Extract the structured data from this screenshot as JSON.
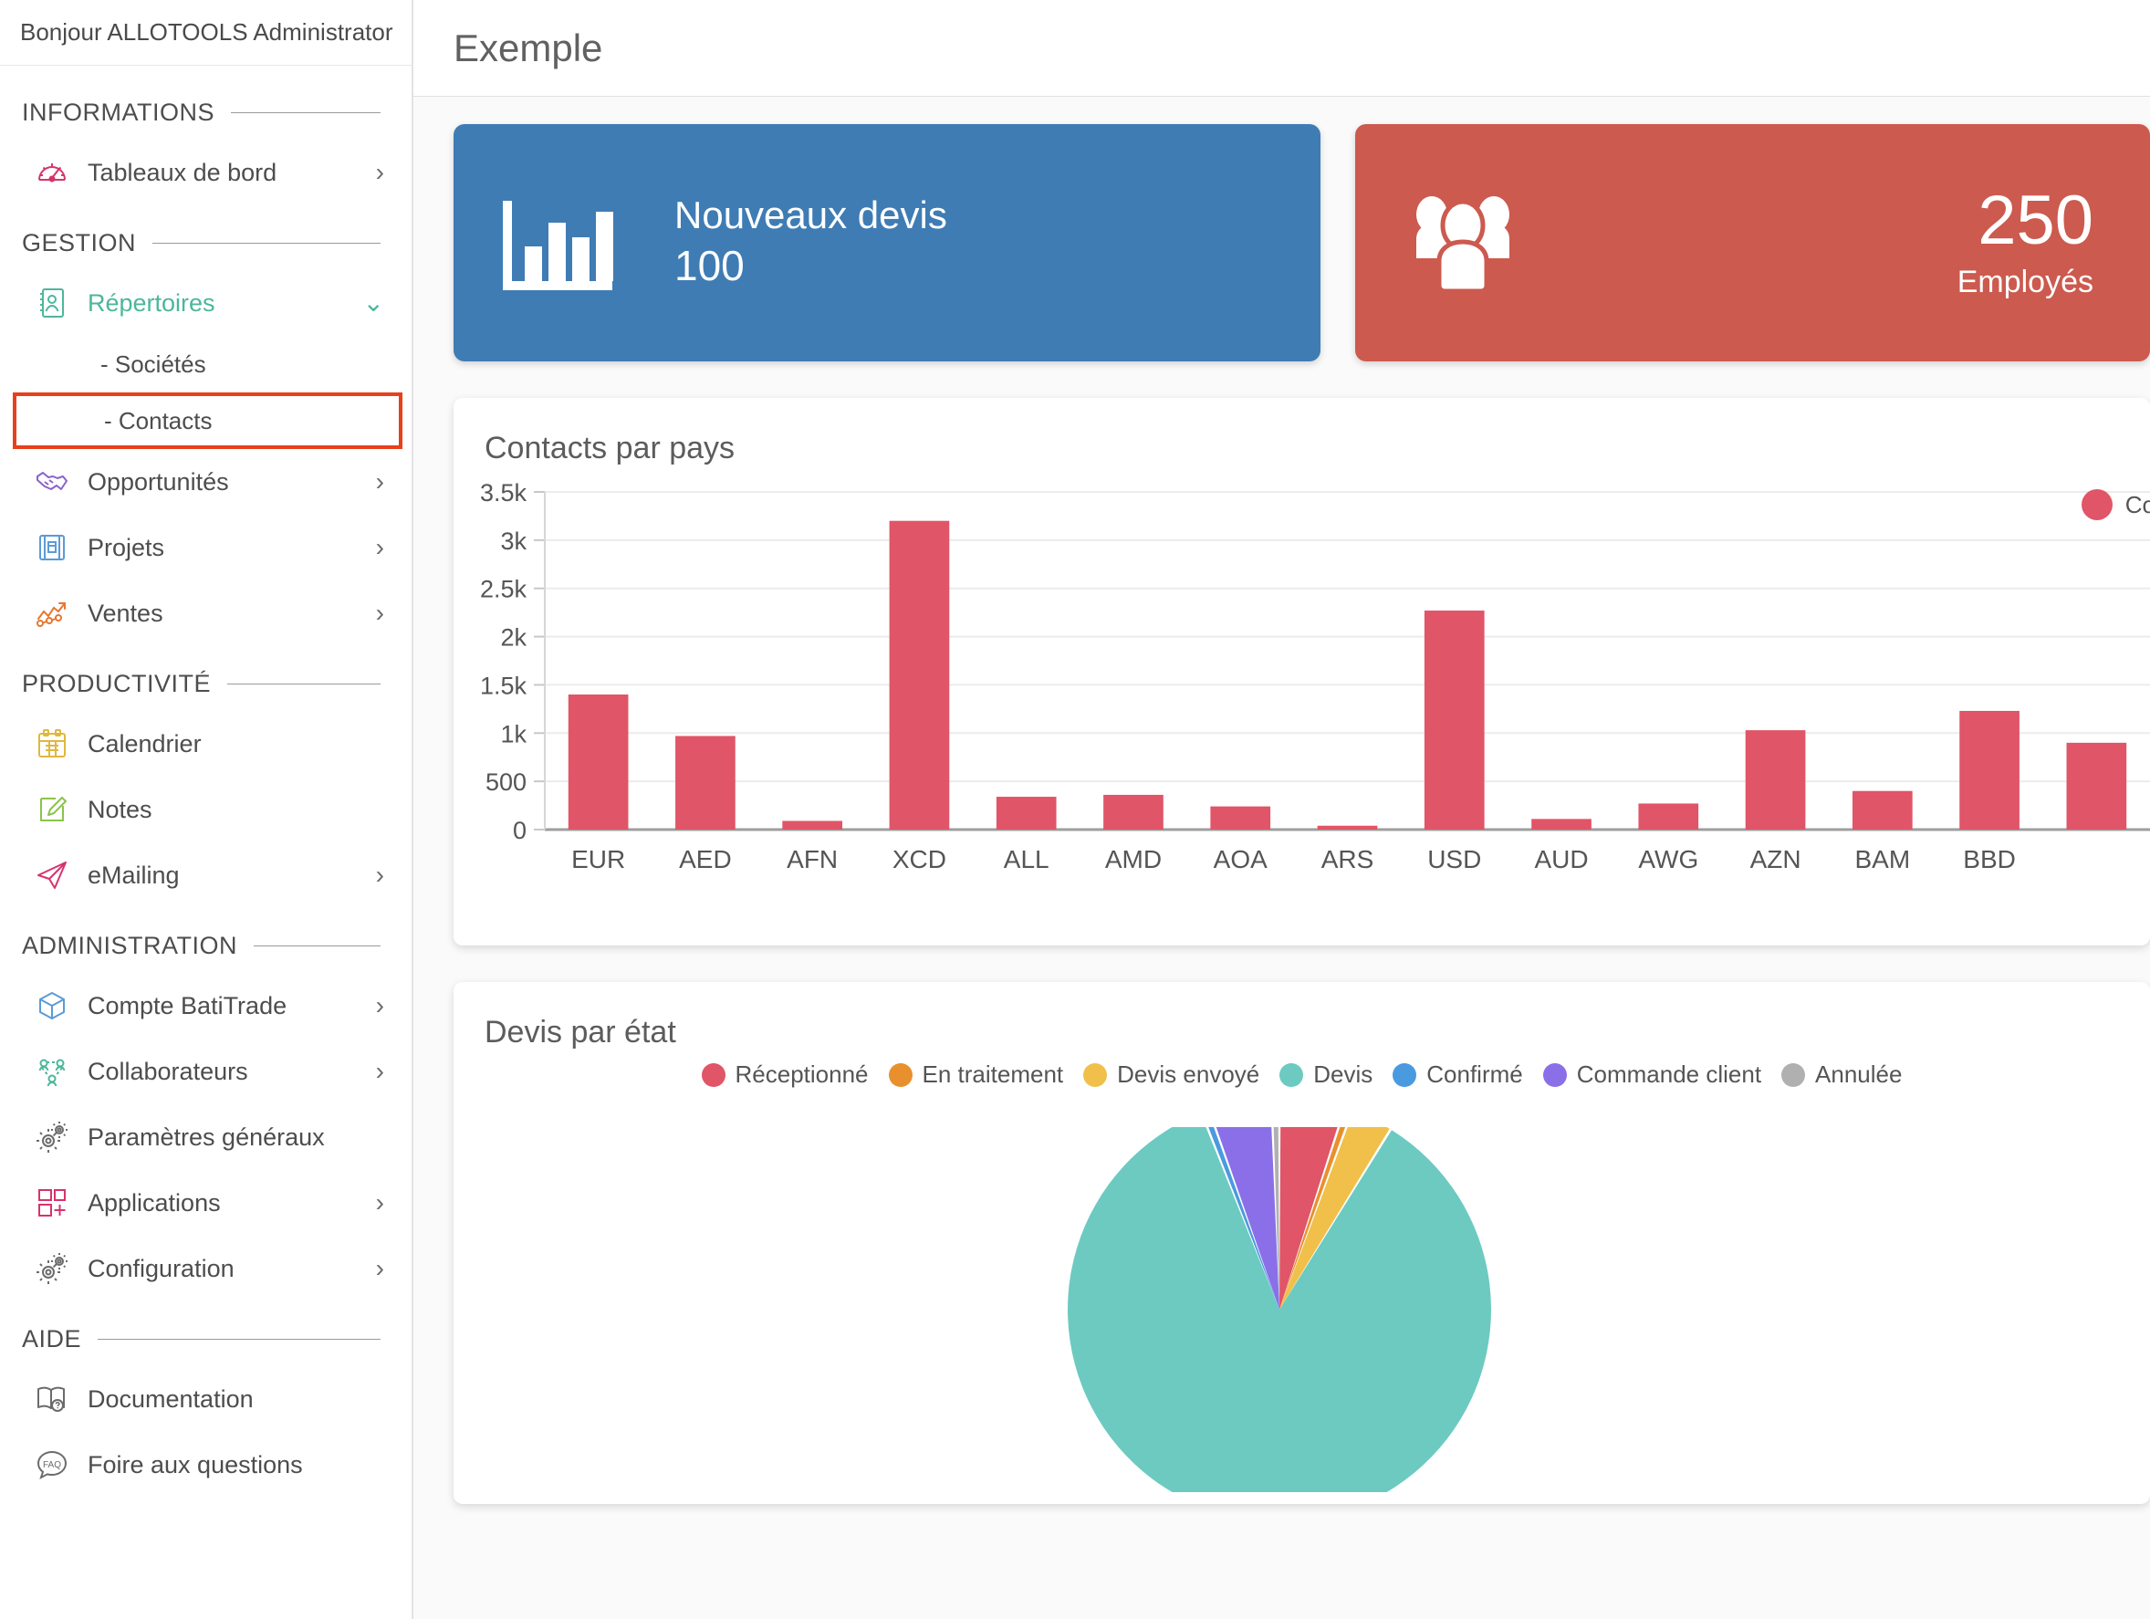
{
  "sidebar": {
    "greeting": "Bonjour ALLOTOOLS Administrator",
    "sections": [
      {
        "title": "INFORMATIONS",
        "items": [
          {
            "label": "Tableaux de bord",
            "icon": "gauge-icon",
            "chevron": "›",
            "active": false,
            "color": "#d6336c"
          }
        ]
      },
      {
        "title": "GESTION",
        "items": [
          {
            "label": "Répertoires",
            "icon": "address-book-icon",
            "chevron": "⌄",
            "active": true,
            "color": "#4cb79a"
          },
          {
            "label": "- Sociétés",
            "sub": true,
            "highlight": false
          },
          {
            "label": "- Contacts",
            "sub": true,
            "highlight": true
          },
          {
            "label": "Opportunités",
            "icon": "handshake-icon",
            "chevron": "›",
            "active": false,
            "color": "#8b63c9"
          },
          {
            "label": "Projets",
            "icon": "blueprint-icon",
            "chevron": "›",
            "active": false,
            "color": "#5b9bd5"
          },
          {
            "label": "Ventes",
            "icon": "trend-up-icon",
            "chevron": "›",
            "active": false,
            "color": "#e8762c"
          }
        ]
      },
      {
        "title": "PRODUCTIVITÉ",
        "items": [
          {
            "label": "Calendrier",
            "icon": "calendar-icon",
            "chevron": "",
            "active": false,
            "color": "#e0b83c"
          },
          {
            "label": "Notes",
            "icon": "pencil-note-icon",
            "chevron": "",
            "active": false,
            "color": "#8bc34a"
          },
          {
            "label": "eMailing",
            "icon": "paper-plane-icon",
            "chevron": "›",
            "active": false,
            "color": "#d6336c"
          }
        ]
      },
      {
        "title": "ADMINISTRATION",
        "items": [
          {
            "label": "Compte BatiTrade",
            "icon": "cube-icon",
            "chevron": "›",
            "active": false,
            "color": "#5b9bd5"
          },
          {
            "label": "Collaborateurs",
            "icon": "people-network-icon",
            "chevron": "›",
            "active": false,
            "color": "#4cb79a"
          },
          {
            "label": "Paramètres généraux",
            "icon": "gears-icon",
            "chevron": "",
            "active": false,
            "color": "#6b6b6b"
          },
          {
            "label": "Applications",
            "icon": "app-grid-plus-icon",
            "chevron": "›",
            "active": false,
            "color": "#d6336c"
          },
          {
            "label": "Configuration",
            "icon": "gears-icon",
            "chevron": "›",
            "active": false,
            "color": "#6b6b6b"
          }
        ]
      },
      {
        "title": "AIDE",
        "items": [
          {
            "label": "Documentation",
            "icon": "book-help-icon",
            "chevron": "",
            "active": false,
            "color": "#6b6b6b"
          },
          {
            "label": "Foire aux questions",
            "icon": "faq-bubble-icon",
            "chevron": "",
            "active": false,
            "color": "#6b6b6b"
          }
        ]
      }
    ]
  },
  "topbar": {
    "title": "Exemple"
  },
  "kpi": {
    "new_quotes": {
      "label": "Nouveaux devis",
      "value": "100",
      "color": "#3f7cb4",
      "icon": "bar-chart-icon"
    },
    "employees": {
      "value": "250",
      "label": "Employés",
      "color": "#cc5a4e",
      "icon": "users-group-icon"
    }
  },
  "panels": {
    "contacts_by_country": {
      "title": "Contacts par pays",
      "legend_label": "Co"
    },
    "quotes_by_state": {
      "title": "Devis par état"
    }
  },
  "chart_data": [
    {
      "type": "bar",
      "title": "Contacts par pays",
      "xlabel": "",
      "ylabel": "",
      "ylim": [
        0,
        3500
      ],
      "yticks": [
        0,
        500,
        1000,
        1500,
        2000,
        2500,
        3000,
        3500
      ],
      "ytick_labels": [
        "0",
        "500",
        "1k",
        "1.5k",
        "2k",
        "2.5k",
        "3k",
        "3.5k"
      ],
      "grid": true,
      "legend": {
        "position": "top-right",
        "entries": [
          "Co"
        ]
      },
      "color": "#e05567",
      "categories": [
        "EUR",
        "AED",
        "AFN",
        "XCD",
        "ALL",
        "AMD",
        "AOA",
        "ARS",
        "USD",
        "AUD",
        "AWG",
        "AZN",
        "BAM",
        "BBD",
        ""
      ],
      "values": [
        1400,
        970,
        90,
        3200,
        340,
        360,
        240,
        40,
        2270,
        110,
        270,
        1030,
        400,
        1230,
        900
      ]
    },
    {
      "type": "pie",
      "title": "Devis par état",
      "legend": {
        "position": "top-center"
      },
      "labels": [
        "Réceptionné",
        "En traitement",
        "Devis envoyé",
        "Devis",
        "Confirmé",
        "Commande client",
        "Annulée"
      ],
      "colors": [
        "#e05567",
        "#e8902e",
        "#f0c04a",
        "#6ccac1",
        "#4a9ae0",
        "#8b6fe8",
        "#b0b0b0"
      ],
      "values": [
        5.0,
        0.6,
        3.2,
        85.2,
        0.6,
        4.8,
        0.6
      ]
    }
  ]
}
